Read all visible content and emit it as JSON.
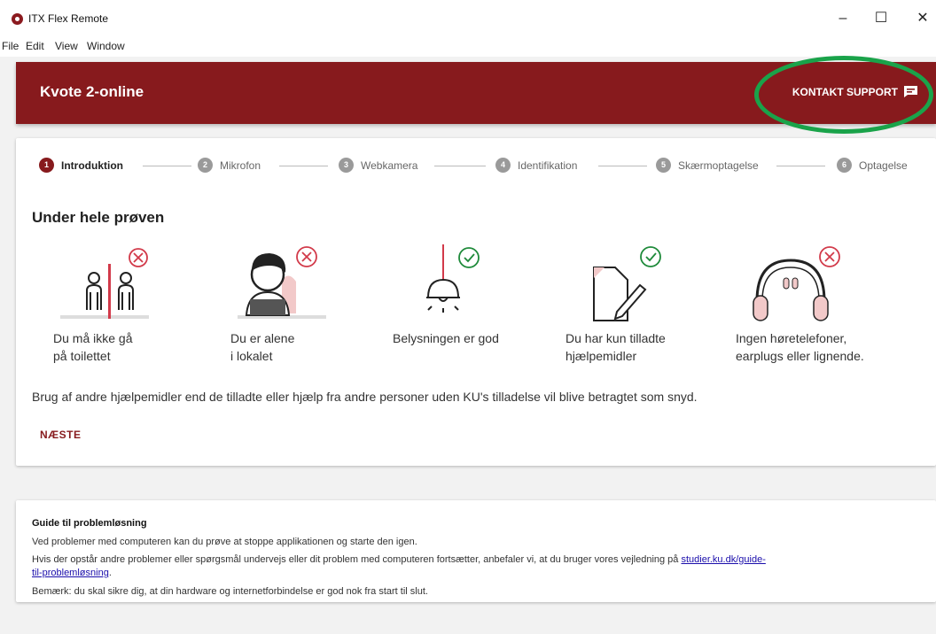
{
  "window": {
    "title": "ITX Flex Remote",
    "menu": [
      "File",
      "Edit",
      "View",
      "Window"
    ],
    "controls": {
      "minimize": "–",
      "maximize": "☐",
      "close": "✕"
    }
  },
  "header": {
    "title": "Kvote 2-online",
    "support_label": "KONTAKT SUPPORT"
  },
  "stepper": {
    "steps": [
      {
        "num": "1",
        "label": "Introduktion"
      },
      {
        "num": "2",
        "label": "Mikrofon"
      },
      {
        "num": "3",
        "label": "Webkamera"
      },
      {
        "num": "4",
        "label": "Identifikation"
      },
      {
        "num": "5",
        "label": "Skærmoptagelse"
      },
      {
        "num": "6",
        "label": "Optagelse"
      }
    ]
  },
  "intro": {
    "title": "Under hele prøven",
    "rules": [
      {
        "line1": "Du må ikke gå",
        "line2": "på toilettet",
        "icon": "toilet-forbidden-icon"
      },
      {
        "line1": "Du er alene",
        "line2": "i lokalet",
        "icon": "alone-in-room-icon"
      },
      {
        "line1": "Belysningen er god",
        "line2": "",
        "icon": "lamp-ok-icon"
      },
      {
        "line1": "Du har kun tilladte",
        "line2": "hjælpemidler",
        "icon": "allowed-aids-icon"
      },
      {
        "line1": "Ingen høretelefoner,",
        "line2": "earplugs eller lignende.",
        "icon": "no-headphones-icon"
      }
    ],
    "notice": "Brug af andre hjælpemidler end de tilladte eller hjælp fra andre personer uden KU's tilladelse vil blive betragtet som snyd.",
    "next_label": "NÆSTE"
  },
  "guide": {
    "title": "Guide til problemløsning",
    "line1": "Ved problemer med computeren kan du prøve at stoppe applikationen og starte den igen.",
    "line2_text": "Hvis der opstår andre problemer eller spørgsmål undervejs eller dit problem med computeren fortsætter, anbefaler vi, at du bruger vores vejledning på ",
    "line2_link_a": "studier.ku.dk/guide-",
    "line2_link_b": "til-problemløsning",
    "line2_end": ".",
    "line3": "Bemærk: du skal sikre dig, at din hardware og internetforbindelse er god nok fra start til slut."
  },
  "colors": {
    "brand": "#871a1d",
    "ok": "#1e8a3a",
    "forbidden": "#d23a4a",
    "highlight": "#1aa34a"
  }
}
